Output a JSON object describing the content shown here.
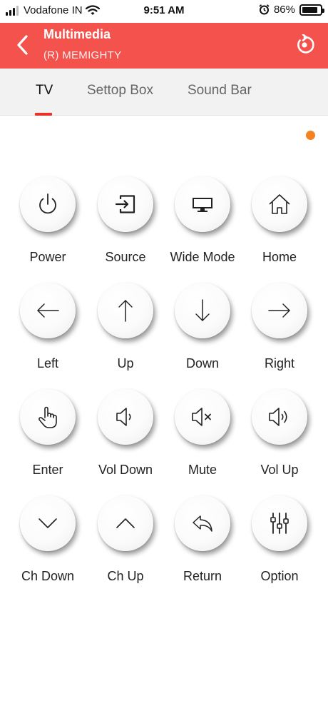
{
  "status_bar": {
    "carrier": "Vodafone IN",
    "time": "9:51 AM",
    "battery": "86%",
    "battery_level": 0.86
  },
  "header": {
    "title": "Multimedia",
    "subtitle": "(R) MEMIGHTY",
    "accent": "#f4534d"
  },
  "tabs": [
    {
      "label": "TV",
      "active": true
    },
    {
      "label": "Settop Box",
      "active": false
    },
    {
      "label": "Sound Bar",
      "active": false
    }
  ],
  "indicator_color": "#f58220",
  "buttons": [
    {
      "label": "Power",
      "icon": "power-icon"
    },
    {
      "label": "Source",
      "icon": "source-icon"
    },
    {
      "label": "Wide Mode",
      "icon": "monitor-icon"
    },
    {
      "label": "Home",
      "icon": "home-icon"
    },
    {
      "label": "Left",
      "icon": "arrow-left-icon"
    },
    {
      "label": "Up",
      "icon": "arrow-up-icon"
    },
    {
      "label": "Down",
      "icon": "arrow-down-icon"
    },
    {
      "label": "Right",
      "icon": "arrow-right-icon"
    },
    {
      "label": "Enter",
      "icon": "hand-pointer-icon"
    },
    {
      "label": "Vol Down",
      "icon": "volume-down-icon"
    },
    {
      "label": "Mute",
      "icon": "mute-icon"
    },
    {
      "label": "Vol Up",
      "icon": "volume-up-icon"
    },
    {
      "label": "Ch Down",
      "icon": "chevron-down-icon"
    },
    {
      "label": "Ch Up",
      "icon": "chevron-up-icon"
    },
    {
      "label": "Return",
      "icon": "return-icon"
    },
    {
      "label": "Option",
      "icon": "sliders-icon"
    }
  ]
}
